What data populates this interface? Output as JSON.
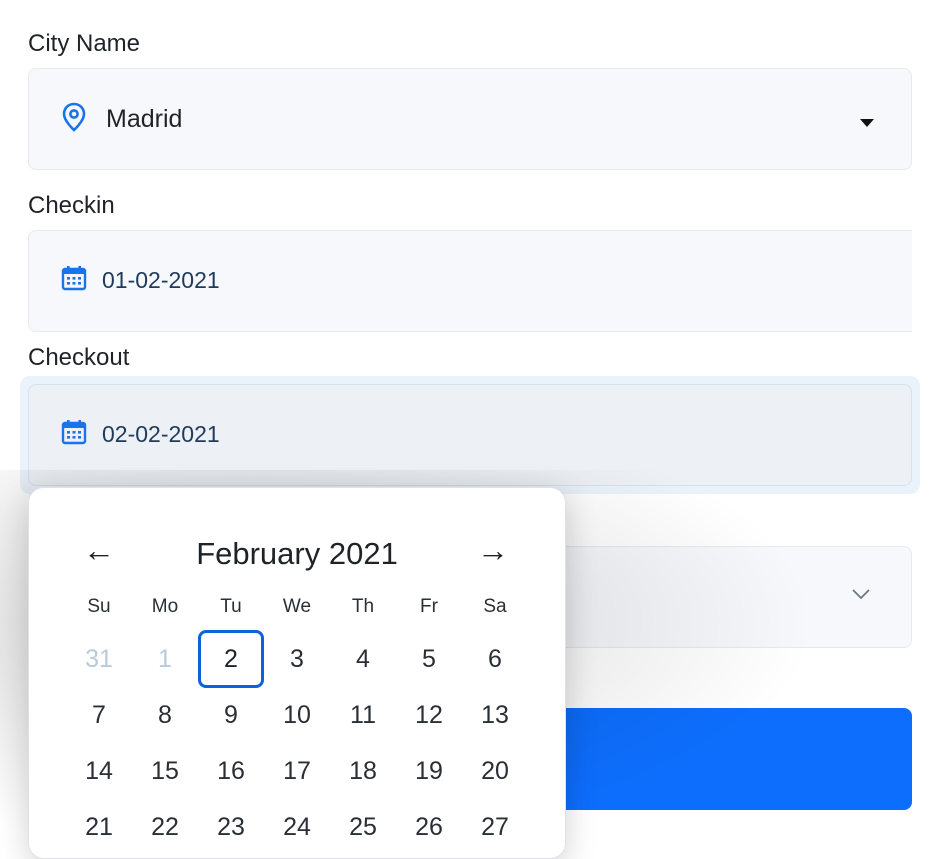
{
  "city": {
    "label": "City Name",
    "value": "Madrid"
  },
  "checkin": {
    "label": "Checkin",
    "value": "01-02-2021"
  },
  "checkout": {
    "label": "Checkout",
    "value": "02-02-2021"
  },
  "calendar": {
    "month_title": "February 2021",
    "prev_arrow": "←",
    "next_arrow": "→",
    "weekdays": [
      "Su",
      "Mo",
      "Tu",
      "We",
      "Th",
      "Fr",
      "Sa"
    ],
    "days": [
      {
        "label": "31",
        "muted": true
      },
      {
        "label": "1",
        "muted": true
      },
      {
        "label": "2",
        "selected": true
      },
      {
        "label": "3"
      },
      {
        "label": "4"
      },
      {
        "label": "5"
      },
      {
        "label": "6"
      },
      {
        "label": "7"
      },
      {
        "label": "8"
      },
      {
        "label": "9"
      },
      {
        "label": "10"
      },
      {
        "label": "11"
      },
      {
        "label": "12"
      },
      {
        "label": "13"
      },
      {
        "label": "14"
      },
      {
        "label": "15"
      },
      {
        "label": "16"
      },
      {
        "label": "17"
      },
      {
        "label": "18"
      },
      {
        "label": "19"
      },
      {
        "label": "20"
      },
      {
        "label": "21"
      },
      {
        "label": "22"
      },
      {
        "label": "23"
      },
      {
        "label": "24"
      },
      {
        "label": "25"
      },
      {
        "label": "26"
      },
      {
        "label": "27"
      }
    ]
  },
  "colors": {
    "accent": "#0d6efd",
    "selected_border": "#0d63d6",
    "icon_blue": "#1a73e8"
  }
}
